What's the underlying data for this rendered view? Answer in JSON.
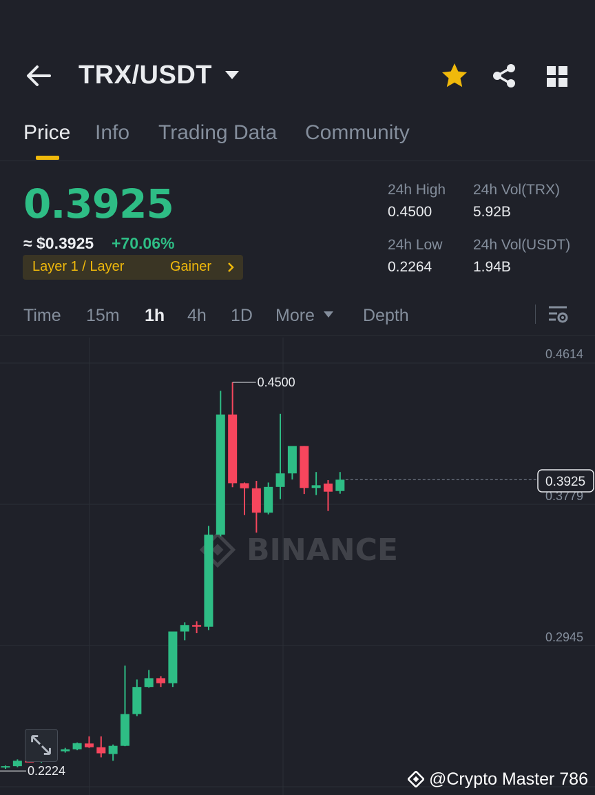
{
  "header": {
    "pair": "TRX/USDT",
    "back_icon": "arrow-left-icon",
    "favorite_icon": "star-icon",
    "share_icon": "share-icon",
    "menu_icon": "grid-icon",
    "favorite_color": "#f0b90b"
  },
  "tabs": [
    {
      "label": "Price",
      "active": true
    },
    {
      "label": "Info",
      "active": false
    },
    {
      "label": "Trading Data",
      "active": false
    },
    {
      "label": "Community",
      "active": false
    }
  ],
  "ticker": {
    "last_price": "0.3925",
    "usd_price": "≈ $0.3925",
    "change_pct": "+70.06%",
    "tag_primary": "Layer 1 / Layer",
    "tag_secondary": "Gainer",
    "up_color": "#2ebd85",
    "down_color": "#f6465d"
  },
  "stats": {
    "high_label": "24h High",
    "high_value": "0.4500",
    "vol_trx_label": "24h Vol(TRX)",
    "vol_trx_value": "5.92B",
    "low_label": "24h Low",
    "low_value": "0.2264",
    "vol_usdt_label": "24h Vol(USDT)",
    "vol_usdt_value": "1.94B"
  },
  "intervals": [
    {
      "label": "Time",
      "active": false
    },
    {
      "label": "15m",
      "active": false
    },
    {
      "label": "1h",
      "active": true
    },
    {
      "label": "4h",
      "active": false
    },
    {
      "label": "1D",
      "active": false
    },
    {
      "label": "More",
      "active": false
    },
    {
      "label": "Depth",
      "active": false
    }
  ],
  "chart_data": {
    "type": "candlestick",
    "price_labels": [
      "0.4614",
      "0.3779",
      "0.2945"
    ],
    "current_price_label": "0.3925",
    "high_marker": "0.4500",
    "low_marker": "0.2224",
    "watermark": "BINANCE",
    "candles": [
      {
        "o": 0.2224,
        "h": 0.2236,
        "l": 0.2216,
        "c": 0.2232
      },
      {
        "o": 0.2232,
        "h": 0.2272,
        "l": 0.2226,
        "c": 0.2264
      },
      {
        "o": 0.2262,
        "h": 0.2268,
        "l": 0.2254,
        "c": 0.2258
      },
      {
        "o": 0.2258,
        "h": 0.2312,
        "l": 0.2252,
        "c": 0.2304
      },
      {
        "o": 0.2302,
        "h": 0.2324,
        "l": 0.2296,
        "c": 0.232
      },
      {
        "o": 0.232,
        "h": 0.234,
        "l": 0.2312,
        "c": 0.2332
      },
      {
        "o": 0.2332,
        "h": 0.2372,
        "l": 0.2326,
        "c": 0.2368
      },
      {
        "o": 0.2366,
        "h": 0.2408,
        "l": 0.234,
        "c": 0.2344
      },
      {
        "o": 0.2344,
        "h": 0.2408,
        "l": 0.2284,
        "c": 0.2308
      },
      {
        "o": 0.2304,
        "h": 0.236,
        "l": 0.2264,
        "c": 0.2352
      },
      {
        "o": 0.2352,
        "h": 0.2826,
        "l": 0.235,
        "c": 0.254
      },
      {
        "o": 0.254,
        "h": 0.2744,
        "l": 0.2528,
        "c": 0.27
      },
      {
        "o": 0.27,
        "h": 0.28,
        "l": 0.2696,
        "c": 0.2752
      },
      {
        "o": 0.2752,
        "h": 0.2764,
        "l": 0.27,
        "c": 0.2722
      },
      {
        "o": 0.2722,
        "h": 0.288,
        "l": 0.27,
        "c": 0.3028
      },
      {
        "o": 0.3028,
        "h": 0.3082,
        "l": 0.2976,
        "c": 0.3066
      },
      {
        "o": 0.3066,
        "h": 0.3088,
        "l": 0.3018,
        "c": 0.3056
      },
      {
        "o": 0.3056,
        "h": 0.3652,
        "l": 0.3036,
        "c": 0.36
      },
      {
        "o": 0.36,
        "h": 0.445,
        "l": 0.359,
        "c": 0.431
      },
      {
        "o": 0.431,
        "h": 0.45,
        "l": 0.388,
        "c": 0.3904
      },
      {
        "o": 0.3904,
        "h": 0.3908,
        "l": 0.3716,
        "c": 0.3874
      },
      {
        "o": 0.3874,
        "h": 0.3918,
        "l": 0.3612,
        "c": 0.373
      },
      {
        "o": 0.373,
        "h": 0.3908,
        "l": 0.372,
        "c": 0.3882
      },
      {
        "o": 0.3882,
        "h": 0.4314,
        "l": 0.381,
        "c": 0.3962
      },
      {
        "o": 0.3962,
        "h": 0.4102,
        "l": 0.3926,
        "c": 0.4124
      },
      {
        "o": 0.4124,
        "h": 0.4124,
        "l": 0.384,
        "c": 0.3876
      },
      {
        "o": 0.3876,
        "h": 0.397,
        "l": 0.3834,
        "c": 0.3892
      },
      {
        "o": 0.3902,
        "h": 0.3922,
        "l": 0.374,
        "c": 0.3854
      },
      {
        "o": 0.3858,
        "h": 0.397,
        "l": 0.3842,
        "c": 0.3925
      }
    ]
  },
  "footer": {
    "credit": "@Crypto Master 786",
    "expand_icon": "expand-icon"
  }
}
